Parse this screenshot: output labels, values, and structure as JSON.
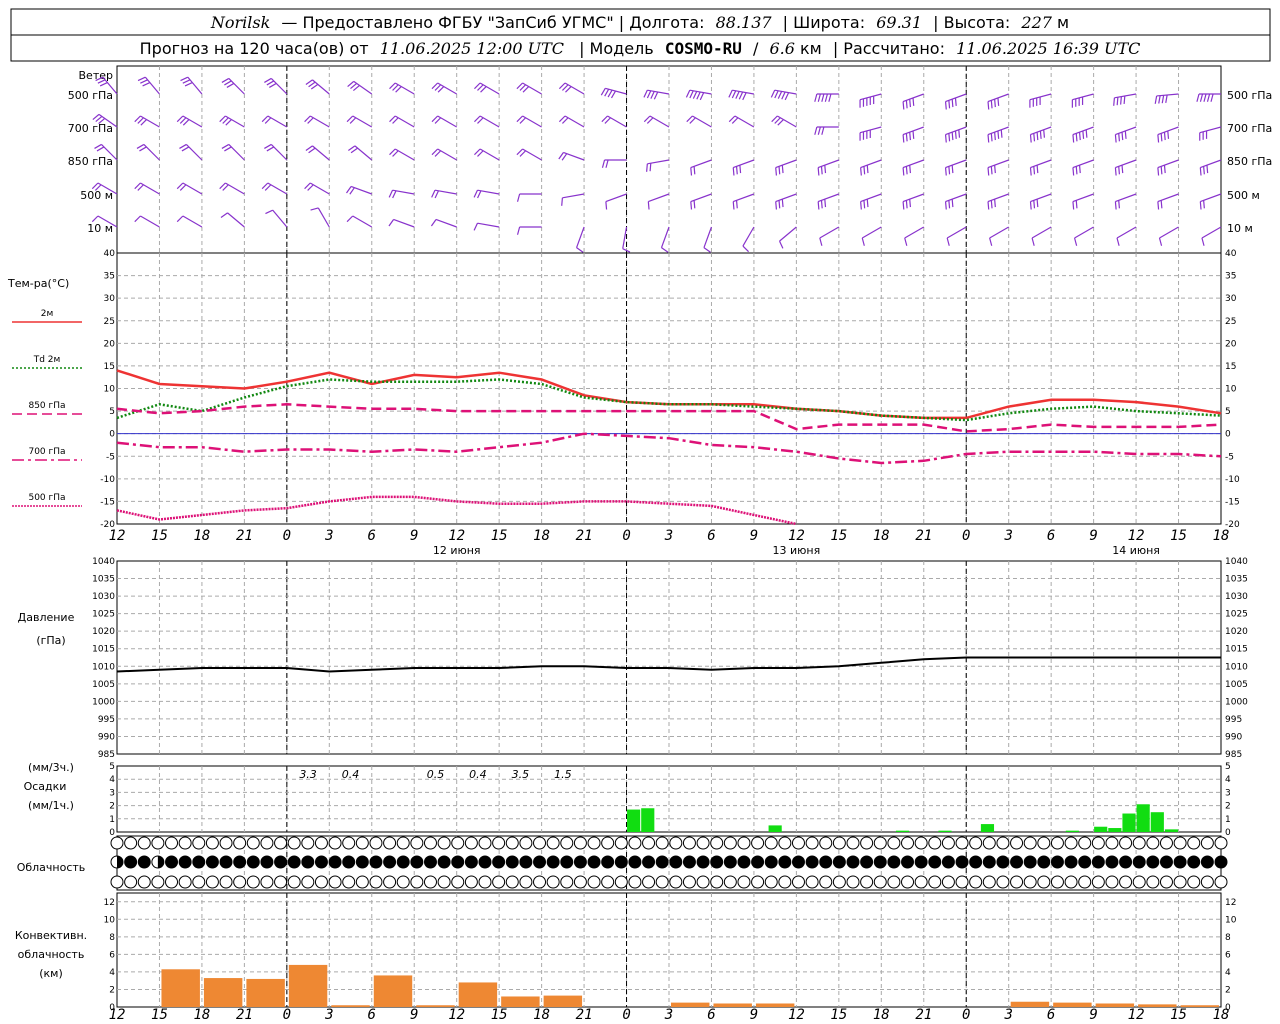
{
  "header": {
    "station": "Norilsk",
    "line1": "— Предоставлено ФГБУ \"ЗапСиб УГМС\" | Долгота:",
    "lon": "88.137",
    "lat_label": "| Широта:",
    "lat": "69.31",
    "alt_label": "| Высота:",
    "alt": "227",
    "alt_unit": "м",
    "line2_a": "Прогноз на 120 часа(ов) от",
    "run": "11.06.2025 12:00 UTC",
    "line2_b": "| Модель",
    "model": "COSMO-RU",
    "line2_c": "/",
    "res": "6.6",
    "res_unit": "км",
    "line2_d": "| Рассчитано:",
    "calc": "11.06.2025 16:39 UTC"
  },
  "labels": {
    "wind_title": "Ветер",
    "wind_levels": [
      "500 гПа",
      "700 гПа",
      "850 гПа",
      "500 м",
      "10  м"
    ],
    "temp_title": "Тем-ра(°С)",
    "temp_legend": [
      "2м",
      "Td 2м",
      "850 гПа",
      "700 гПа",
      "500 гПа"
    ],
    "pres_title": "Давление",
    "pres_unit": "(гПа)",
    "precip_unit_top": "(мм/3ч.)",
    "precip_title": "Осадки",
    "precip_unit_bot": "(мм/1ч.)",
    "cloud_title": "Облачность",
    "conv_title_1": "Конвективн.",
    "conv_title_2": "облачность",
    "conv_unit": "(км)"
  },
  "colors": {
    "t2m": "#ee3333",
    "td2m": "#118811",
    "t850": "#dd1177",
    "t700": "#dd1177",
    "t500": "#dd1177",
    "wind": "#8833cc",
    "pressure": "#000000",
    "precip": "#11dd11",
    "conv": "#ee8833",
    "zero_line": "#3333cc"
  },
  "chart_data": {
    "type": "line",
    "x_labels": [
      "12",
      "15",
      "18",
      "21",
      "0",
      "3",
      "6",
      "9",
      "12",
      "15",
      "18",
      "21",
      "0",
      "3",
      "6",
      "9",
      "12",
      "15",
      "18",
      "21",
      "0",
      "3",
      "6",
      "9",
      "12",
      "15",
      "18"
    ],
    "dates": [
      {
        "label": "12 июня",
        "at_index": 8
      },
      {
        "label": "13 июня",
        "at_index": 16
      },
      {
        "label": "14 июня",
        "at_index": 24
      }
    ],
    "day_boundaries": [
      4,
      12,
      20
    ],
    "wind": {
      "units": "m/s",
      "levels": [
        {
          "name": "500 гПа",
          "dir": [
            320,
            320,
            320,
            315,
            315,
            310,
            305,
            300,
            300,
            300,
            300,
            300,
            285,
            280,
            280,
            280,
            280,
            270,
            255,
            250,
            250,
            250,
            255,
            255,
            260,
            265,
            270
          ],
          "speed": [
            12,
            12,
            12,
            12,
            12,
            12,
            12,
            12,
            12,
            12,
            12,
            12,
            18,
            18,
            20,
            22,
            22,
            22,
            20,
            18,
            18,
            18,
            18,
            18,
            18,
            18,
            20
          ]
        },
        {
          "name": "700 гПа",
          "dir": [
            305,
            300,
            300,
            300,
            300,
            300,
            300,
            300,
            300,
            300,
            300,
            300,
            300,
            300,
            300,
            300,
            300,
            270,
            255,
            250,
            250,
            250,
            250,
            250,
            250,
            250,
            255
          ],
          "speed": [
            12,
            12,
            12,
            12,
            10,
            10,
            10,
            10,
            10,
            10,
            10,
            10,
            10,
            10,
            10,
            10,
            12,
            14,
            16,
            18,
            20,
            20,
            20,
            20,
            18,
            16,
            14
          ]
        },
        {
          "name": "850 гПа",
          "dir": [
            315,
            315,
            315,
            315,
            315,
            310,
            310,
            300,
            300,
            300,
            300,
            290,
            270,
            260,
            250,
            250,
            250,
            250,
            250,
            250,
            250,
            250,
            250,
            250,
            250,
            250,
            250
          ],
          "speed": [
            10,
            10,
            10,
            10,
            10,
            10,
            8,
            8,
            8,
            8,
            8,
            8,
            8,
            8,
            10,
            12,
            14,
            14,
            14,
            14,
            14,
            14,
            14,
            14,
            12,
            12,
            12
          ]
        },
        {
          "name": "500 м",
          "dir": [
            300,
            300,
            300,
            300,
            300,
            300,
            290,
            280,
            280,
            280,
            270,
            260,
            250,
            250,
            250,
            250,
            250,
            250,
            250,
            250,
            250,
            250,
            250,
            250,
            250,
            250,
            250
          ],
          "speed": [
            10,
            10,
            10,
            10,
            10,
            8,
            8,
            8,
            8,
            8,
            6,
            6,
            6,
            6,
            8,
            10,
            12,
            12,
            12,
            12,
            12,
            12,
            12,
            10,
            10,
            10,
            10
          ]
        },
        {
          "name": "10  м",
          "dir": [
            300,
            300,
            300,
            310,
            320,
            330,
            300,
            290,
            290,
            280,
            270,
            200,
            190,
            200,
            200,
            210,
            230,
            240,
            240,
            240,
            240,
            240,
            240,
            240,
            240,
            240,
            240
          ],
          "speed": [
            6,
            6,
            6,
            6,
            6,
            6,
            6,
            6,
            6,
            5,
            5,
            4,
            4,
            4,
            4,
            5,
            6,
            6,
            6,
            6,
            6,
            6,
            6,
            6,
            6,
            6,
            6
          ]
        }
      ]
    },
    "temperature": {
      "ylim": [
        -20,
        40
      ],
      "series": [
        {
          "name": "2м",
          "style": "solid",
          "values": [
            14,
            11,
            10.5,
            10,
            11.5,
            13.5,
            11,
            13,
            12.5,
            13.5,
            12,
            8.5,
            7,
            6.5,
            6.5,
            6.5,
            5.5,
            5,
            4,
            3.5,
            3.5,
            6,
            7.5,
            7.5,
            7,
            6,
            4.5
          ]
        },
        {
          "name": "Td 2м",
          "style": "dotted",
          "values": [
            3.5,
            6.5,
            5,
            8,
            10.5,
            12,
            11.5,
            11.5,
            11.5,
            12,
            11,
            8,
            7,
            6.5,
            6.5,
            6,
            5.5,
            5,
            4,
            3.5,
            3,
            4.5,
            5.5,
            6,
            5,
            4.5,
            4
          ]
        },
        {
          "name": "850 гПа",
          "style": "dashed",
          "values": [
            5.5,
            4.5,
            5,
            6,
            6.5,
            6,
            5.5,
            5.5,
            5,
            5,
            5,
            5,
            5,
            5,
            5,
            5,
            1,
            2,
            2,
            2,
            0.5,
            1,
            2,
            1.5,
            1.5,
            1.5,
            2
          ]
        },
        {
          "name": "700 гПа",
          "style": "dashdot",
          "values": [
            -2,
            -3,
            -3,
            -4,
            -3.5,
            -3.5,
            -4,
            -3.5,
            -4,
            -3,
            -2,
            0,
            -0.5,
            -1,
            -2.5,
            -3,
            -4,
            -5.5,
            -6.5,
            -6,
            -4.5,
            -4,
            -4,
            -4,
            -4.5,
            -4.5,
            -5
          ]
        },
        {
          "name": "500 гПа",
          "style": "dotdense",
          "values": [
            -17,
            -19,
            -18,
            -17,
            -16.5,
            -15,
            -14,
            -14,
            -15,
            -15.5,
            -15.5,
            -15,
            -15,
            -15.5,
            -16,
            -18,
            -20,
            null,
            null,
            null,
            null,
            null,
            null,
            null,
            null,
            null,
            null
          ]
        }
      ]
    },
    "pressure": {
      "ylim": [
        985,
        1040
      ],
      "values": [
        1008.5,
        1009,
        1009.5,
        1009.5,
        1009.5,
        1008.5,
        1009,
        1009.5,
        1009.5,
        1009.5,
        1010,
        1010,
        1009.5,
        1009.5,
        1009,
        1009.5,
        1009.5,
        1010,
        1011,
        1012,
        1012.5,
        1012.5,
        1012.5,
        1012.5,
        1012.5,
        1012.5,
        1012.5
      ]
    },
    "precipitation": {
      "ylim": [
        0,
        5
      ],
      "hourly": [
        0,
        0,
        0,
        0,
        0,
        0,
        0,
        0,
        0,
        0,
        0,
        0,
        0,
        0,
        0,
        0,
        0,
        0,
        0,
        0,
        0,
        0,
        0,
        0,
        0,
        0,
        0,
        0,
        0,
        0,
        0,
        0,
        0,
        0,
        0,
        0,
        1.7,
        1.8,
        0,
        0,
        0,
        0,
        0,
        0,
        0,
        0,
        0.5,
        0,
        0,
        0,
        0,
        0,
        0,
        0,
        0,
        0.1,
        0,
        0,
        0.1,
        0,
        0,
        0.6,
        0,
        0,
        0,
        0,
        0,
        0.1,
        0,
        0.4,
        0.3,
        1.4,
        2.1,
        1.5,
        0.2,
        0,
        0,
        0,
        0,
        0,
        0,
        0,
        0,
        0,
        0,
        0,
        0,
        0,
        0,
        0,
        0,
        0,
        0,
        0,
        0,
        0,
        0,
        0,
        0,
        0,
        0,
        0,
        0,
        0,
        0,
        0,
        0,
        0,
        0,
        0,
        0,
        0,
        0,
        0,
        0,
        0,
        0,
        0,
        0,
        0,
        0,
        0,
        0,
        0,
        0,
        0,
        0,
        0,
        0,
        0,
        0,
        0,
        0,
        0,
        0,
        0,
        0,
        0,
        0,
        0,
        0,
        0,
        0,
        0,
        0,
        0,
        0,
        0,
        0,
        0,
        0,
        0,
        0,
        0,
        0,
        0,
        0,
        0,
        0,
        0,
        0,
        0,
        0,
        0,
        0,
        0,
        0,
        0,
        0,
        0,
        0,
        0,
        0,
        0,
        0,
        0,
        0,
        0,
        0,
        0,
        0,
        0,
        0,
        0,
        0,
        0,
        0,
        0,
        0,
        0,
        0,
        0,
        0,
        0,
        0,
        0
      ],
      "totals_3h": [
        {
          "value": "3.3",
          "at_index": 4.5
        },
        {
          "value": "0.4",
          "at_index": 5.5
        },
        {
          "value": "0.5",
          "at_index": 7.5
        },
        {
          "value": "0.4",
          "at_index": 8.5
        },
        {
          "value": "3.5",
          "at_index": 9.5
        },
        {
          "value": "1.5",
          "at_index": 10.5
        }
      ]
    },
    "cloudiness": {
      "units": "octas",
      "high": [
        0,
        0,
        0,
        0,
        0,
        0,
        0,
        0,
        0,
        0,
        0,
        0,
        0,
        0,
        0,
        0,
        0,
        0,
        0,
        0,
        0,
        0,
        0,
        0,
        0,
        0,
        0,
        0,
        0,
        0,
        0,
        0,
        0,
        0,
        0,
        0,
        0,
        0,
        0,
        0,
        0,
        0,
        0,
        0,
        0,
        0,
        0,
        0,
        0,
        0,
        0,
        0,
        0,
        0,
        0,
        0,
        0,
        0,
        0,
        0,
        0,
        0,
        0,
        0,
        0,
        0,
        0,
        0,
        0,
        0,
        0,
        0,
        0,
        0,
        0,
        0,
        0,
        0,
        0,
        0,
        0,
        0
      ],
      "middle": [
        4,
        8,
        8,
        4,
        8,
        8,
        8,
        8,
        8,
        8,
        8,
        8,
        8,
        8,
        8,
        8,
        8,
        8,
        8,
        8,
        8,
        8,
        8,
        8,
        8,
        8,
        8,
        8,
        8,
        8,
        8,
        8,
        8,
        8,
        8,
        8,
        8,
        8,
        8,
        8,
        8,
        8,
        8,
        8,
        8,
        8,
        8,
        8,
        8,
        8,
        8,
        8,
        8,
        8,
        8,
        8,
        8,
        8,
        8,
        8,
        8,
        8,
        8,
        8,
        8,
        8,
        8,
        8,
        8,
        8,
        8,
        8,
        8,
        8,
        8,
        8,
        8,
        8,
        8,
        8,
        8,
        8
      ],
      "low": [
        0,
        0,
        0,
        0,
        0,
        0,
        0,
        0,
        0,
        0,
        0,
        0,
        0,
        0,
        0,
        0,
        0,
        0,
        0,
        0,
        0,
        0,
        0,
        0,
        0,
        0,
        0,
        0,
        0,
        0,
        0,
        0,
        0,
        0,
        0,
        0,
        0,
        0,
        0,
        0,
        0,
        0,
        0,
        0,
        0,
        0,
        0,
        0,
        0,
        0,
        0,
        0,
        0,
        0,
        0,
        0,
        0,
        0,
        0,
        0,
        0,
        0,
        0,
        0,
        0,
        0,
        0,
        0,
        0,
        0,
        0,
        0,
        0,
        0,
        0,
        0,
        0,
        0,
        0,
        0,
        0,
        0
      ]
    },
    "convective": {
      "ylim": [
        0,
        13
      ],
      "values": [
        0,
        4.3,
        3.3,
        3.2,
        4.8,
        0.2,
        3.6,
        0.2,
        2.8,
        1.2,
        1.3,
        0,
        0,
        0.5,
        0.4,
        0.4,
        0,
        0,
        0,
        0,
        0,
        0.6,
        0.5,
        0.4,
        0.3,
        0.2,
        0
      ]
    }
  }
}
